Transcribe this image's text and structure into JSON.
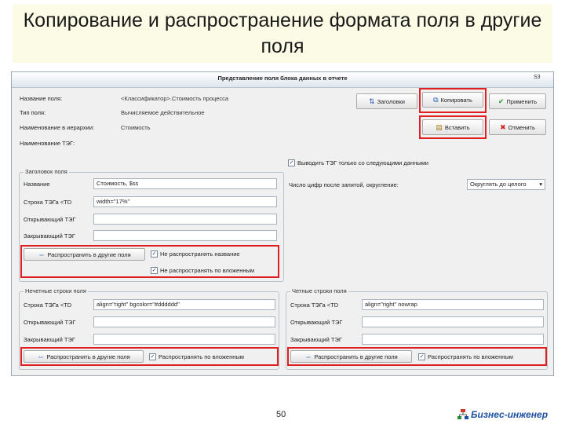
{
  "slide": {
    "title": "Копирование и распространение формата поля в другие поля",
    "page_number": "50",
    "logo_text": "Бизнес-инженер"
  },
  "dialog": {
    "title": "Представление поля блока данных в отчете",
    "code": "S3",
    "rows": [
      {
        "label": "Название поля:",
        "value": "<Классификатор>.Стоимость процесса"
      },
      {
        "label": "Тип поля:",
        "value": "Вычисляемое действительное"
      },
      {
        "label": "Наименование в иерархии:",
        "value": "Стоимость"
      },
      {
        "label": "Наименование ТЭГ:",
        "value": ""
      }
    ],
    "buttons": {
      "headers": "Заголовки",
      "copy": "Копировать",
      "apply": "Применить",
      "paste": "Вставить",
      "cancel": "Отменить"
    },
    "output_check": "Выводить ТЭГ только со следующими данными",
    "fixed_dropdown_label": "Число цифр после запятой, округление:",
    "fixed_dropdown_value": "Округлять до целого",
    "header_group": {
      "title": "Заголовок поля",
      "name_label": "Название",
      "name_value": "Стоимость, $ss",
      "tag_label": "Строка ТЭГа <TD",
      "tag_value": "width=\"17%\"",
      "open_label": "Открывающий ТЭГ",
      "close_label": "Закрывающий ТЭГ",
      "spread_button": "Распространить в другие поля",
      "check1": "Не распространять название",
      "check2": "Не распространять по вложенным"
    },
    "odd_group": {
      "title": "Нечетные строки поля",
      "tag_label": "Строка ТЭГа <TD",
      "tag_value": "align=\"right\" bgcolor=\"#dddddd\"",
      "open_label": "Открывающий ТЭГ",
      "close_label": "Закрывающий ТЭГ",
      "spread_button": "Распространить в другие поля",
      "check": "Распространять по вложенным"
    },
    "even_group": {
      "title": "Четные строки поля",
      "tag_label": "Строка ТЭГа <TD",
      "tag_value": "align=\"right\" nowrap",
      "open_label": "Открывающий ТЭГ",
      "close_label": "Закрывающий ТЭГ",
      "spread_button": "Распространить в другие поля",
      "check": "Распространять по вложенным"
    }
  },
  "colors": {
    "highlight": "#e02020",
    "accent": "#1d4fa0"
  }
}
